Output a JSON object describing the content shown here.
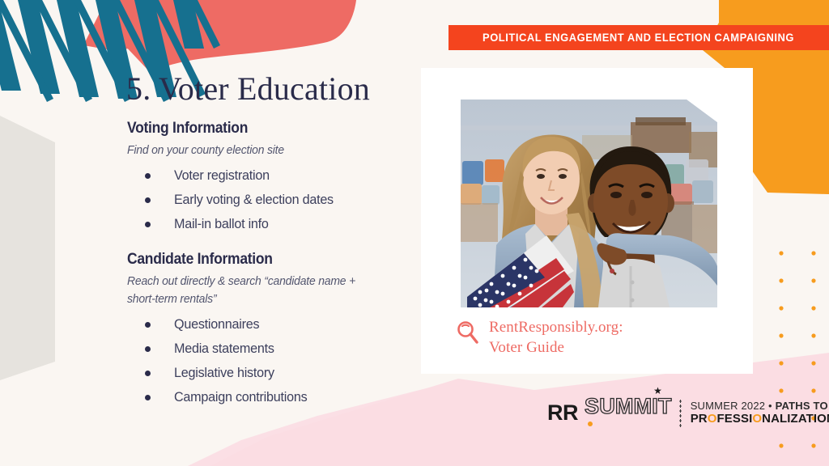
{
  "slide": {
    "title": "5. Voter Education",
    "banner_label": "POLITICAL ENGAGEMENT AND ELECTION CAMPAIGNING"
  },
  "sections": [
    {
      "heading": "Voting Information",
      "subheading": "Find on your county election site",
      "bullets": [
        "Voter registration",
        "Early voting & election dates",
        "Mail-in ballot info"
      ]
    },
    {
      "heading": "Candidate Information",
      "subheading": "Reach out directly & search “candidate name + short-term rentals”",
      "bullets": [
        "Questionnaires",
        "Media statements",
        "Legislative history",
        "Campaign contributions"
      ]
    }
  ],
  "media": {
    "photo_alt": "Two smiling young people outdoors at a festival holding an American flag",
    "link_line1": "RentResponsibly.org:",
    "link_line2": "Voter Guide",
    "search_icon": "magnifying-glass-icon"
  },
  "footer": {
    "logo_rr": "RR",
    "logo_summit": "SUMMIT",
    "star": "★",
    "tagline_line1_light": "SUMMER 2022",
    "tagline_bullet": "•",
    "tagline_line1_bold": "PATHS TO",
    "tagline_line2_pre": "PR",
    "tagline_line2_accent": "O",
    "tagline_line2_mid": "FESSI",
    "tagline_line2_accent2": "O",
    "tagline_line2_post": "NALIZATION"
  },
  "colors": {
    "background": "#FAF6F2",
    "navy": "#2A2B4A",
    "red_banner": "#F4441E",
    "orange": "#F79C1E",
    "coral": "#EE6B64",
    "teal": "#16708F",
    "pink": "#FBDDE3",
    "gray_shape": "#E6E3DE",
    "card_white": "#FFFFFF"
  }
}
